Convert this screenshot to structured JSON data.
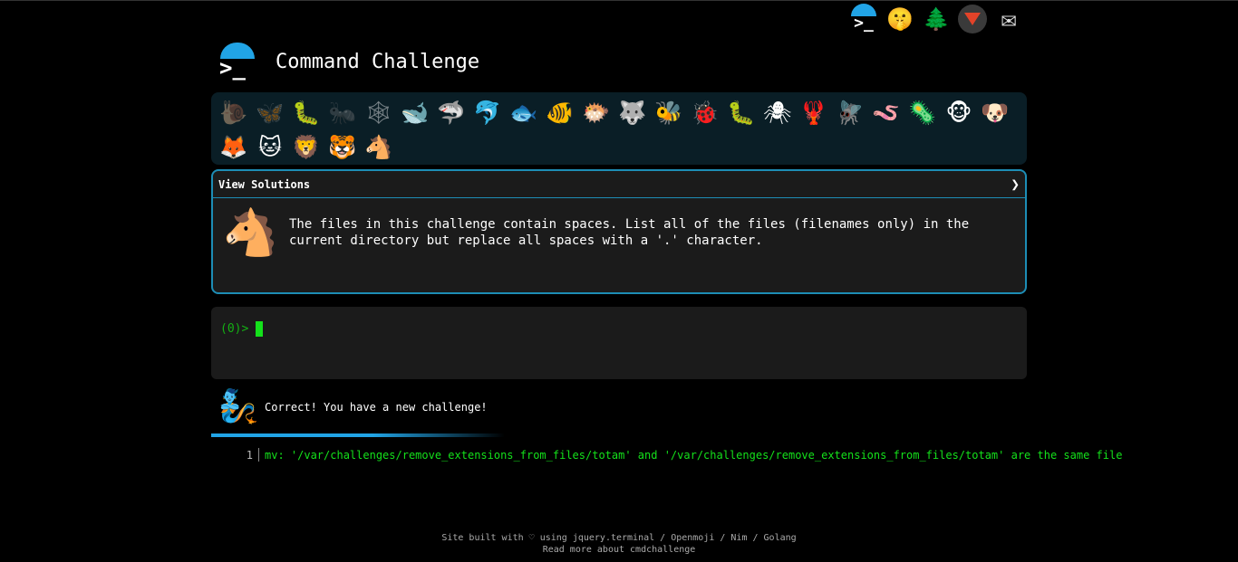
{
  "top_icons": [
    {
      "icon": "terminal-logo-icon"
    },
    {
      "icon": "shushing-face-icon",
      "glyph": "🤫"
    },
    {
      "icon": "christmas-tree-icon",
      "glyph": "🌲"
    },
    {
      "icon": "gitlab-icon"
    },
    {
      "icon": "envelope-icon",
      "glyph": "✉"
    }
  ],
  "header": {
    "logo_glyph": ">_",
    "title": "Command Challenge"
  },
  "animals": [
    {
      "name": "snail",
      "glyph": "🐌",
      "done": true
    },
    {
      "name": "butterfly",
      "glyph": "🦋",
      "done": true
    },
    {
      "name": "caterpillar",
      "glyph": "🐛",
      "done": false
    },
    {
      "name": "ant",
      "glyph": "🐜",
      "done": true
    },
    {
      "name": "web",
      "glyph": "🕸",
      "done": true
    },
    {
      "name": "whale",
      "glyph": "🐋",
      "done": false
    },
    {
      "name": "shark",
      "glyph": "🦈",
      "done": false
    },
    {
      "name": "dolphin",
      "glyph": "🐬",
      "done": false
    },
    {
      "name": "fish",
      "glyph": "🐟",
      "done": false
    },
    {
      "name": "tropical-fish",
      "glyph": "🐠",
      "done": false
    },
    {
      "name": "blowfish",
      "glyph": "🐡",
      "done": false
    },
    {
      "name": "wolf",
      "glyph": "🐺",
      "done": false
    },
    {
      "name": "bee",
      "glyph": "🐝",
      "done": false
    },
    {
      "name": "ladybug",
      "glyph": "🐞",
      "done": false
    },
    {
      "name": "worm",
      "glyph": "🐛",
      "done": false
    },
    {
      "name": "spider",
      "glyph": "🕷",
      "done": false
    },
    {
      "name": "lobster",
      "glyph": "🦞",
      "done": false
    },
    {
      "name": "fly",
      "glyph": "🪰",
      "done": false
    },
    {
      "name": "snake",
      "glyph": "🪱",
      "done": false
    },
    {
      "name": "microbe",
      "glyph": "🦠",
      "done": false
    },
    {
      "name": "monkey",
      "glyph": "🐵",
      "done": false
    },
    {
      "name": "dog",
      "glyph": "🐶",
      "done": false
    },
    {
      "name": "fox",
      "glyph": "🦊",
      "done": false
    },
    {
      "name": "cat",
      "glyph": "🐱",
      "done": false
    },
    {
      "name": "lion",
      "glyph": "🦁",
      "done": false
    },
    {
      "name": "tiger",
      "glyph": "🐯",
      "done": false
    },
    {
      "name": "horse",
      "glyph": "🐴",
      "done": false
    }
  ],
  "solutions": {
    "label": "View Solutions",
    "chevron": "❯"
  },
  "challenge": {
    "icon": "🐴",
    "text": "The files in this challenge contain spaces. List all of the files (filenames only) in the current directory but replace all spaces with a '.' character."
  },
  "terminal": {
    "prompt": "(0)>"
  },
  "feedback": {
    "icon": "🧞",
    "message": "Correct! You have a new challenge!"
  },
  "progress": {
    "fraction": 0.6
  },
  "output": {
    "line_number": "1",
    "text": "mv: '/var/challenges/remove_extensions_from_files/totam' and '/var/challenges/remove_extensions_from_files/totam' are the same file"
  },
  "footer": {
    "line1": "Site built with ♡ using jquery.terminal / Openmoji / Nim / Golang",
    "line2": "Read more about cmdchallenge"
  }
}
